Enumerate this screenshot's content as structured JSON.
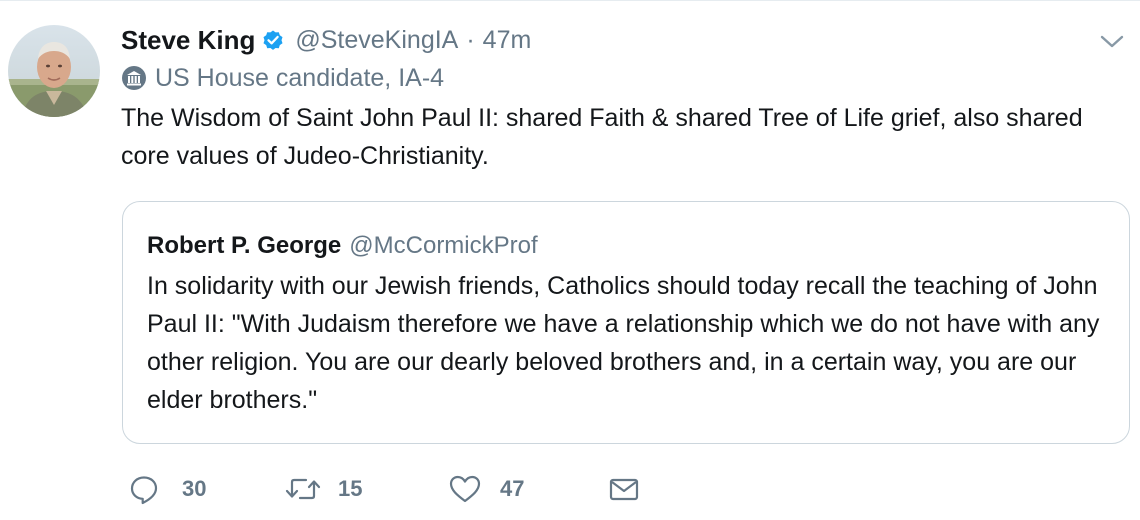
{
  "tweet": {
    "display_name": "Steve King",
    "handle": "@SteveKingIA",
    "separator": "·",
    "time": "47m",
    "label": "US House candidate, IA-4",
    "text": "The Wisdom of Saint John Paul II: shared Faith & shared Tree of Life grief, also shared core values of Judeo-Christianity.",
    "verified": true
  },
  "quote": {
    "display_name": "Robert P. George",
    "handle": "@McCormickProf",
    "text": "In solidarity with our Jewish friends, Catholics should today recall the teaching of John Paul II: \"With Judaism therefore we have a relationship which we do not have with any other religion. You are our dearly beloved brothers and, in a certain way, you are our elder brothers.\""
  },
  "actions": {
    "reply_count": "30",
    "retweet_count": "15",
    "like_count": "47"
  },
  "icons": {
    "verified": "verified-badge-icon",
    "caret": "chevron-down-icon",
    "label": "government-building-icon",
    "reply": "reply-icon",
    "retweet": "retweet-icon",
    "like": "heart-icon",
    "dm": "envelope-icon"
  },
  "colors": {
    "text": "#14171a",
    "secondary": "#657786",
    "verified": "#1da1f2",
    "border": "#ccd6dd"
  }
}
